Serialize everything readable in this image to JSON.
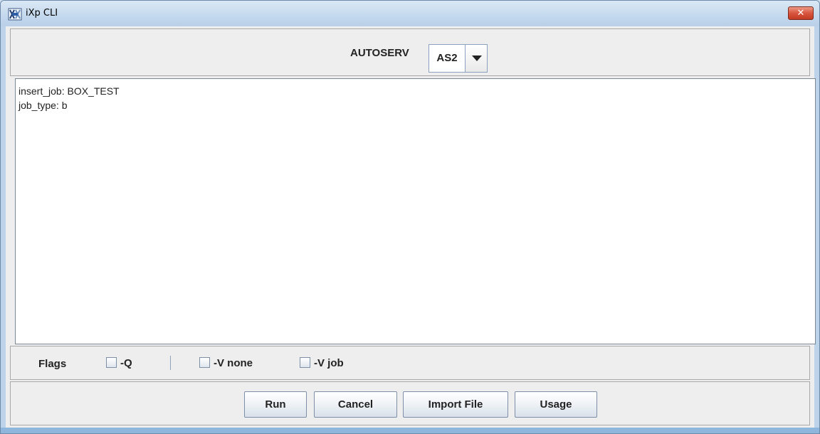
{
  "window": {
    "title": "iXp CLI",
    "app_icon": "ixp-logo-icon",
    "close_glyph": "✕"
  },
  "server": {
    "label": "AUTOSERV",
    "selected": "AS2",
    "arrow_icon": "chevron-down-icon"
  },
  "editor": {
    "text": "insert_job: BOX_TEST\njob_type: b"
  },
  "flags": {
    "label": "Flags",
    "options": [
      {
        "label": "-Q",
        "checked": false
      },
      {
        "label": "-V none",
        "checked": false
      },
      {
        "label": "-V job",
        "checked": false
      }
    ]
  },
  "buttons": {
    "run": "Run",
    "cancel": "Cancel",
    "import_file": "Import File",
    "usage": "Usage"
  }
}
